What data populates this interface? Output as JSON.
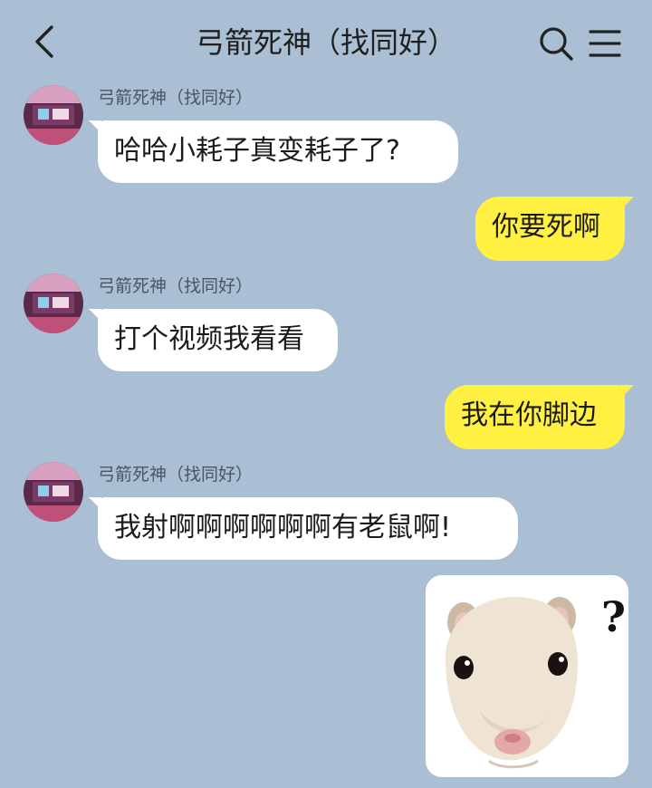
{
  "header": {
    "title": "弓箭死神（找同好）",
    "back_icon": "chevron-left-icon",
    "search_icon": "search-icon",
    "menu_icon": "hamburger-menu-icon"
  },
  "colors": {
    "background": "#aabfd3",
    "incoming_bubble": "#ffffff",
    "outgoing_bubble": "#fff042"
  },
  "messages": [
    {
      "direction": "incoming",
      "sender": "弓箭死神（找同好）",
      "text": "哈哈小耗子真变耗子了?"
    },
    {
      "direction": "outgoing",
      "text": "你要死啊"
    },
    {
      "direction": "incoming",
      "sender": "弓箭死神（找同好）",
      "text": "打个视频我看看"
    },
    {
      "direction": "outgoing",
      "text": "我在你脚边"
    },
    {
      "direction": "incoming",
      "sender": "弓箭死神（找同好）",
      "text": "我射啊啊啊啊啊啊有老鼠啊!"
    },
    {
      "direction": "outgoing",
      "type": "sticker",
      "sticker": "hamster-question-sticker",
      "sticker_text": "?"
    }
  ]
}
